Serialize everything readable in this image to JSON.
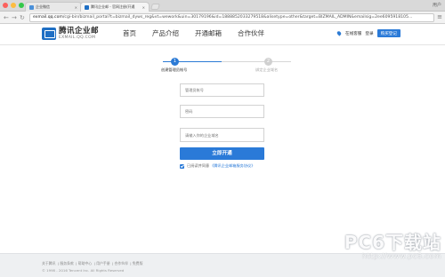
{
  "browser": {
    "tabs": [
      {
        "label": "企业微信",
        "active": false,
        "favicon_color": "#4a90d9"
      },
      {
        "label": "腾讯企业邮 - 官网注册/开通",
        "active": true,
        "favicon_color": "#1f6fc4"
      }
    ],
    "url_host": "exmail.qq.com",
    "url_path": "/cgi-bin/bizmail_portal?t=bizmail_dyws_reg&vt=wework&uin=30179196&id=1888852033279518&alisetype=other&target=BIZMAIL_ADMIN&emailsig=2ee6095918105…",
    "user_label": "用户"
  },
  "header": {
    "logo_cn": "腾讯企业邮",
    "logo_en": "EXMAIL.QQ.COM",
    "nav": [
      "首页",
      "产品介绍",
      "开通邮箱",
      "合作伙伴"
    ],
    "online_consult": "在线客服",
    "login": "登录",
    "buy": "购买登记"
  },
  "steps": [
    {
      "number": "1",
      "label": "创建管理员帐号",
      "active": true
    },
    {
      "number": "2",
      "label": "绑定企业域名",
      "active": false
    }
  ],
  "form": {
    "admin_placeholder": "管理员帐号",
    "password_placeholder": "密码",
    "domain_placeholder": "请输入你的企业域名",
    "submit_label": "立即开通",
    "agree_checked": true,
    "agree_text": "已阅读并同意",
    "agree_link": "《腾讯企业邮箱服务协议》"
  },
  "footer": {
    "links": [
      "关于腾讯",
      "服务条款",
      "帮助中心",
      "用户手册",
      "合作伙伴",
      "免费版"
    ],
    "copyright": "© 1998 - 2016 Tencent Inc. All Rights Reserved"
  },
  "watermark": {
    "brand": "PC6下载站",
    "url": "http://www.pc6.com"
  },
  "colors": {
    "accent": "#2a7ad8",
    "close": "#fc605c",
    "minimize": "#fdbc40",
    "maximize": "#34c84a"
  }
}
